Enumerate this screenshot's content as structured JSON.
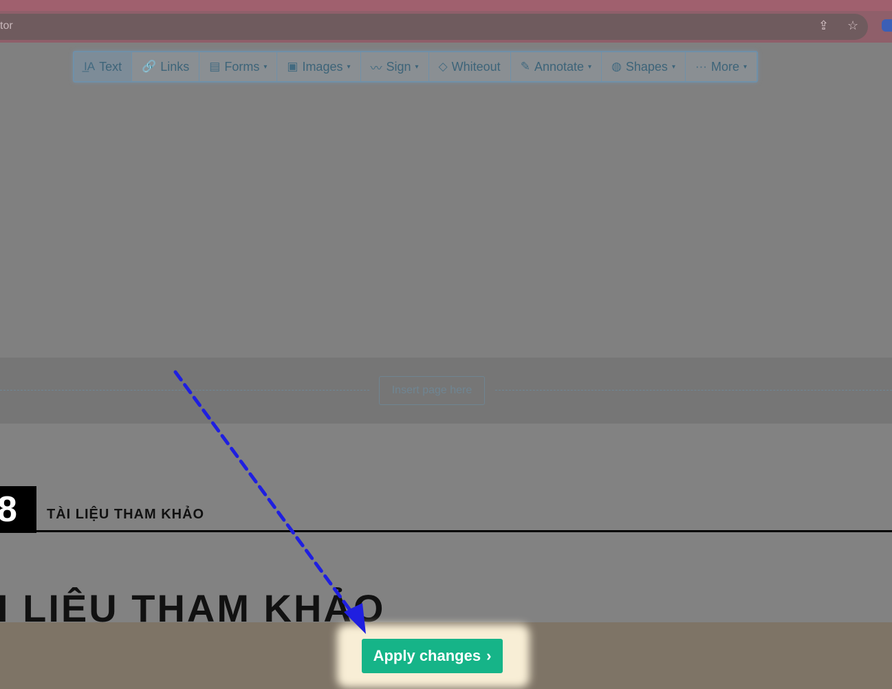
{
  "browser": {
    "address_fragment": "tor",
    "icons": [
      "share-icon",
      "star-icon",
      "extension-icon"
    ],
    "share_glyph": "⇪",
    "star_glyph": "☆"
  },
  "toolbar": {
    "items": [
      {
        "label": "Text",
        "icon": "text-icon",
        "glyph": "I̲A",
        "dropdown": false,
        "active": true
      },
      {
        "label": "Links",
        "icon": "link-icon",
        "glyph": "🔗",
        "dropdown": false
      },
      {
        "label": "Forms",
        "icon": "form-icon",
        "glyph": "▤",
        "dropdown": true
      },
      {
        "label": "Images",
        "icon": "image-icon",
        "glyph": "▣",
        "dropdown": true
      },
      {
        "label": "Sign",
        "icon": "signature-icon",
        "glyph": "〰",
        "dropdown": true
      },
      {
        "label": "Whiteout",
        "icon": "eraser-icon",
        "glyph": "◇",
        "dropdown": false
      },
      {
        "label": "Annotate",
        "icon": "pencil-icon",
        "glyph": "✎",
        "dropdown": true
      },
      {
        "label": "Shapes",
        "icon": "shapes-icon",
        "glyph": "◍",
        "dropdown": true
      },
      {
        "label": "More",
        "icon": "ellipsis-icon",
        "glyph": "···",
        "dropdown": true
      }
    ],
    "caret": "▾"
  },
  "insert_page": {
    "label": "Insert page here"
  },
  "document": {
    "chapter_number": "8",
    "chapter_title": "TÀI LIỆU THAM KHẢO",
    "heading": "I LIỆU THAM KHẢO"
  },
  "apply": {
    "label": "Apply changes",
    "chevron": "›"
  },
  "colors": {
    "apply_green": "#16b488",
    "highlight_glow": "#fff5dc",
    "arrow_blue": "#1f1fe0"
  }
}
